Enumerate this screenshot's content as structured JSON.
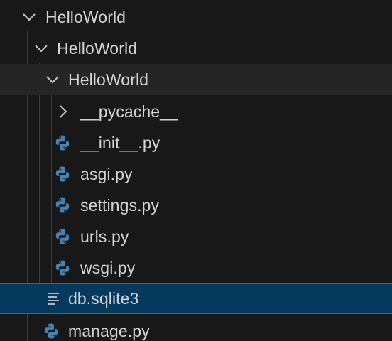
{
  "explorer": {
    "items": [
      {
        "label": "HelloWorld",
        "kind": "folder",
        "expanded": true,
        "icon": "chevron-down-icon"
      },
      {
        "label": "HelloWorld",
        "kind": "folder",
        "expanded": true,
        "icon": "chevron-down-icon"
      },
      {
        "label": "HelloWorld",
        "kind": "folder",
        "expanded": true,
        "icon": "chevron-down-icon"
      },
      {
        "label": "__pycache__",
        "kind": "folder",
        "expanded": false,
        "icon": "chevron-right-icon"
      },
      {
        "label": "__init__.py",
        "kind": "file",
        "icon": "python-file-icon"
      },
      {
        "label": "asgi.py",
        "kind": "file",
        "icon": "python-file-icon"
      },
      {
        "label": "settings.py",
        "kind": "file",
        "icon": "python-file-icon"
      },
      {
        "label": "urls.py",
        "kind": "file",
        "icon": "python-file-icon"
      },
      {
        "label": "wsgi.py",
        "kind": "file",
        "icon": "python-file-icon"
      },
      {
        "label": "db.sqlite3",
        "kind": "file",
        "icon": "text-file-icon",
        "selected": true
      },
      {
        "label": "manage.py",
        "kind": "file",
        "icon": "python-file-icon"
      }
    ]
  },
  "colors": {
    "background": "#181818",
    "hover": "#252526",
    "selection": "#04395e",
    "focus_border": "#0078d4",
    "text": "#d4d4d4",
    "python_blue": "#3e7eb3",
    "indent_guide": "#3f3f3f"
  }
}
